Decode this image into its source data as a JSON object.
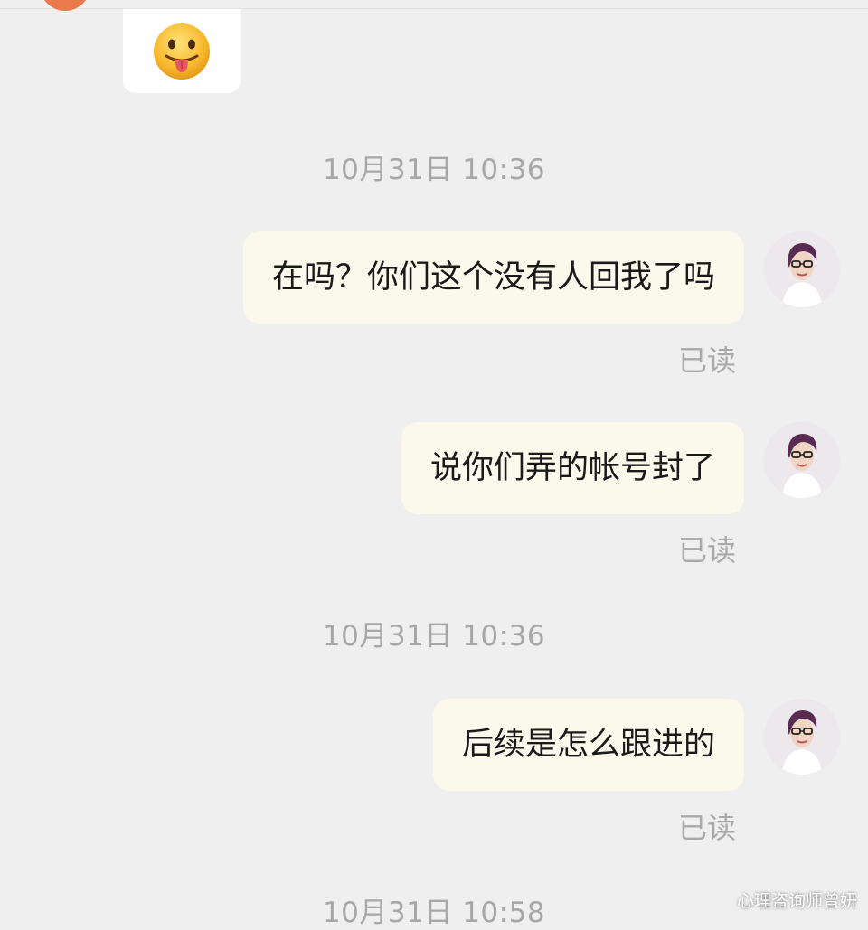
{
  "conversation": {
    "partner_emoji": "face-with-tongue",
    "messages": [
      {
        "timestamp": "10月31日 10:36",
        "text": "在吗？你们这个没有人回我了吗",
        "status": "已读"
      },
      {
        "text": "说你们弄的帐号封了",
        "status": "已读"
      },
      {
        "timestamp": "10月31日 10:36",
        "text": "后续是怎么跟进的",
        "status": "已读"
      },
      {
        "timestamp": "10月31日 10:58"
      }
    ]
  },
  "watermark": "心理咨询师曾妍",
  "colors": {
    "background": "#efefef",
    "self_bubble": "#fbf8ec",
    "timestamp": "#a7a7a7"
  }
}
